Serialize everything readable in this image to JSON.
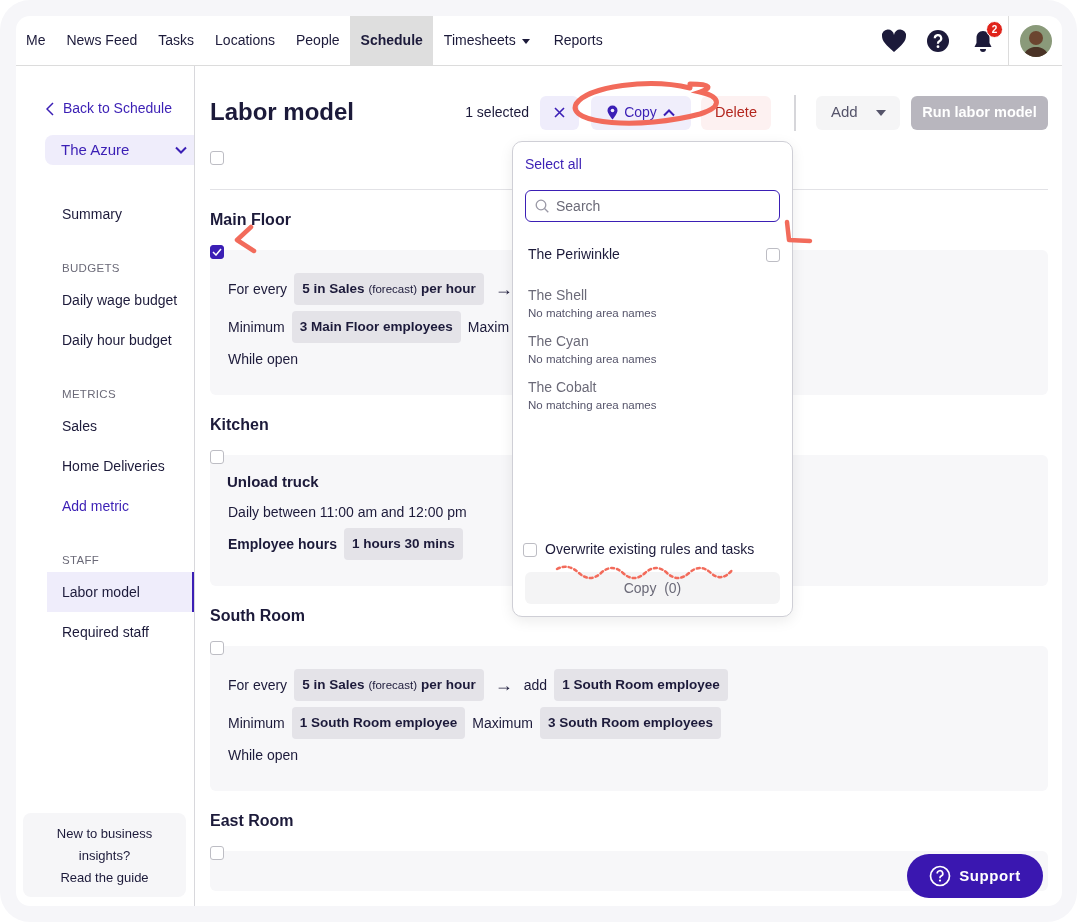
{
  "nav": {
    "items": [
      {
        "label": "Me",
        "selected": false,
        "dropdown": false
      },
      {
        "label": "News Feed",
        "selected": false,
        "dropdown": false
      },
      {
        "label": "Tasks",
        "selected": false,
        "dropdown": false
      },
      {
        "label": "Locations",
        "selected": false,
        "dropdown": false
      },
      {
        "label": "People",
        "selected": false,
        "dropdown": false
      },
      {
        "label": "Schedule",
        "selected": true,
        "dropdown": false
      },
      {
        "label": "Timesheets",
        "selected": false,
        "dropdown": true
      },
      {
        "label": "Reports",
        "selected": false,
        "dropdown": false
      }
    ],
    "notification_count": "2"
  },
  "sidebar": {
    "back_link": "Back to Schedule",
    "location": "The Azure",
    "sections": [
      {
        "items": [
          {
            "label": "Summary",
            "kind": "item",
            "selected": false
          }
        ]
      },
      {
        "heading": "BUDGETS",
        "items": [
          {
            "label": "Daily wage budget",
            "kind": "item",
            "selected": false
          },
          {
            "label": "Daily hour budget",
            "kind": "item",
            "selected": false
          }
        ]
      },
      {
        "heading": "METRICS",
        "items": [
          {
            "label": "Sales",
            "kind": "item",
            "selected": false
          },
          {
            "label": "Home Deliveries",
            "kind": "item",
            "selected": false
          },
          {
            "label": "Add metric",
            "kind": "link",
            "selected": false
          }
        ]
      },
      {
        "heading": "STAFF",
        "items": [
          {
            "label": "Labor model",
            "kind": "item",
            "selected": true
          },
          {
            "label": "Required staff",
            "kind": "item",
            "selected": false
          }
        ]
      }
    ],
    "help": {
      "text": "New to business insights?",
      "link": "Read the guide"
    }
  },
  "header": {
    "title": "Labor model",
    "selected_count": "1 selected",
    "copy_button": "Copy",
    "copy_expanded": true,
    "delete_button": "Delete",
    "add_button": "Add",
    "run_button": "Run labor model",
    "run_disabled": true
  },
  "select_all_checked": false,
  "areas": [
    {
      "name": "Main Floor",
      "checked": true,
      "lines": [
        {
          "segments": [
            {
              "kind": "text",
              "text": "For every"
            },
            {
              "kind": "chip",
              "pieces": [
                {
                  "text": "5 in Sales",
                  "small": false
                },
                {
                  "text": "(forecast)",
                  "small": true
                },
                {
                  "text": "per hour",
                  "small": false
                }
              ]
            },
            {
              "kind": "arrow",
              "text": "→"
            }
          ]
        },
        {
          "segments": [
            {
              "kind": "text",
              "text": "Minimum"
            },
            {
              "kind": "chip",
              "pieces": [
                {
                  "text": "3 Main Floor employees",
                  "small": false
                }
              ]
            },
            {
              "kind": "text",
              "text": "Maxim"
            }
          ]
        },
        {
          "segments": [
            {
              "kind": "text",
              "text": "While open"
            }
          ]
        }
      ]
    },
    {
      "name": "Kitchen",
      "checked": false,
      "task": "Unload truck",
      "lines": [
        {
          "segments": [
            {
              "kind": "text",
              "text": "Daily between 11:00 am and 12:00 pm"
            }
          ]
        },
        {
          "segments": [
            {
              "kind": "label",
              "text": "Employee hours"
            },
            {
              "kind": "chip",
              "pieces": [
                {
                  "text": "1 hours 30 mins",
                  "small": false
                }
              ]
            }
          ]
        }
      ]
    },
    {
      "name": "South Room",
      "checked": false,
      "lines": [
        {
          "segments": [
            {
              "kind": "text",
              "text": "For every"
            },
            {
              "kind": "chip",
              "pieces": [
                {
                  "text": "5 in Sales",
                  "small": false
                },
                {
                  "text": "(forecast)",
                  "small": true
                },
                {
                  "text": "per hour",
                  "small": false
                }
              ]
            },
            {
              "kind": "arrow",
              "text": "→"
            },
            {
              "kind": "text",
              "text": "add"
            },
            {
              "kind": "chip",
              "pieces": [
                {
                  "text": "1 South Room employee",
                  "small": false
                }
              ]
            }
          ]
        },
        {
          "segments": [
            {
              "kind": "text",
              "text": "Minimum"
            },
            {
              "kind": "chip",
              "pieces": [
                {
                  "text": "1 South Room employee",
                  "small": false
                }
              ]
            },
            {
              "kind": "text",
              "text": "Maximum"
            },
            {
              "kind": "chip",
              "pieces": [
                {
                  "text": "3 South Room employees",
                  "small": false
                }
              ]
            }
          ]
        },
        {
          "segments": [
            {
              "kind": "text",
              "text": "While open"
            }
          ]
        }
      ]
    },
    {
      "name": "East Room",
      "checked": false
    }
  ],
  "copy_menu": {
    "select_all": "Select all",
    "search_placeholder": "Search",
    "locations": [
      {
        "name": "The Periwinkle",
        "available": true,
        "checked": false
      },
      {
        "name": "The Shell",
        "available": false,
        "note": "No matching area names"
      },
      {
        "name": "The Cyan",
        "available": false,
        "note": "No matching area names"
      },
      {
        "name": "The Cobalt",
        "available": false,
        "note": "No matching area names"
      }
    ],
    "overwrite": {
      "label": "Overwrite existing rules and tasks",
      "checked": false
    },
    "submit": {
      "label": "Copy  (0)",
      "disabled": true
    }
  },
  "support_button": "Support"
}
